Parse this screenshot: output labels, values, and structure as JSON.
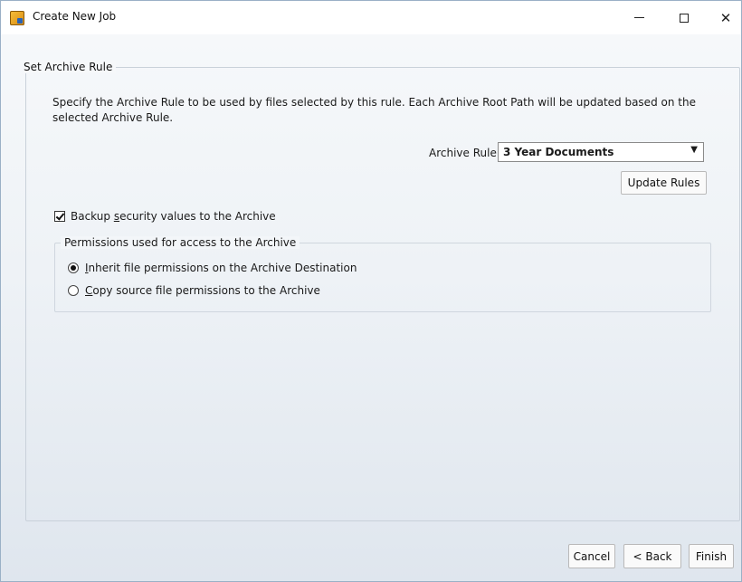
{
  "window": {
    "title": "Create New Job",
    "controls": {
      "minimize": "minimize",
      "maximize": "maximize",
      "close": "✕"
    }
  },
  "archive_rule_group": {
    "legend": "Set Archive Rule",
    "description": "Specify the Archive Rule to be used by files selected by this rule. Each Archive Root Path will be updated based on the selected Archive Rule.",
    "rule_label": "Archive Rule",
    "rule_selected": "3 Year Documents",
    "update_rules_label": "Update Rules"
  },
  "backup": {
    "checked": true,
    "label_pre": "Backup ",
    "label_mnemonic": "s",
    "label_post": "ecurity values to the Archive"
  },
  "permissions_group": {
    "legend": "Permissions used for access to the Archive",
    "options": [
      {
        "mnemonic": "I",
        "rest": "nherit file permissions on the Archive Destination",
        "selected": true
      },
      {
        "mnemonic": "C",
        "rest": "opy source file permissions to the Archive",
        "selected": false
      }
    ]
  },
  "footer": {
    "cancel_label": "Cancel",
    "back_label": "< Back",
    "finish_label": "Finish"
  }
}
